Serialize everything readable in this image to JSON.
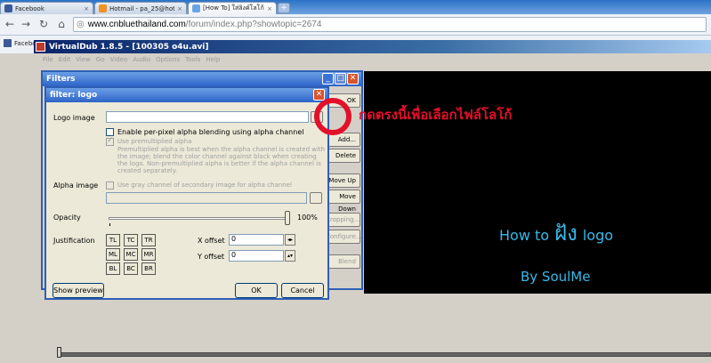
{
  "browser": {
    "tabs": [
      {
        "title": "Facebook",
        "color": "#3b5998"
      },
      {
        "title": "Hotmail - pa_25@hotmail.c...",
        "color": "#f29222"
      },
      {
        "title": "[How To] ใส่ลิงค์โลโก้ลงในไฟ...",
        "color": "#6aa4e5"
      }
    ],
    "new_tab": "+",
    "url_host": "www.cnbluethailand.com",
    "url_path": "/forum/index.php?showtopic=2674",
    "bookmark": "Facebo"
  },
  "vdub": {
    "title": "VirtualDub 1.8.5 - [100305 o4u.avi]",
    "menu": [
      "File",
      "Edit",
      "View",
      "Go",
      "Video",
      "Audio",
      "Options",
      "Tools",
      "Help"
    ],
    "preview_line1_prefix": "How to",
    "preview_line1_big": "ฝัง",
    "preview_line1_suffix": "logo",
    "preview_line2": "By SoulMe"
  },
  "filters_window": {
    "title": "Filters",
    "buttons": [
      "OK",
      "Add...",
      "Delete",
      "Move Up",
      "Move Down",
      "Cropping...",
      "Configure...",
      "Blend"
    ]
  },
  "logo_dialog": {
    "title": "filter: logo",
    "logo_image_label": "Logo image",
    "logo_image_value": "",
    "browse_label": "...",
    "enable_alpha_label": "Enable per-pixel alpha blending using alpha channel",
    "premultiplied_label": "Use premultiplied alpha",
    "premultiplied_note": "Premultiplied alpha is best when the alpha channel is created with the image; blend the color channel against black when creating the logo. Non-premultiplied alpha is better if the alpha channel is created separately.",
    "alpha_image_label": "Alpha image",
    "gray_channel_label": "Use gray channel of secondary image for alpha channel",
    "opacity_label": "Opacity",
    "opacity_value": "100%",
    "opacity_level": 1.0,
    "justification_label": "Justification",
    "justification": [
      [
        "TL",
        "TC",
        "TR"
      ],
      [
        "ML",
        "MC",
        "MR"
      ],
      [
        "BL",
        "BC",
        "BR"
      ]
    ],
    "x_offset_label": "X offset",
    "x_offset_value": "0",
    "y_offset_label": "Y offset",
    "y_offset_value": "0",
    "show_preview": "Show preview",
    "ok": "OK",
    "cancel": "Cancel"
  },
  "annotation": {
    "text": "กดตรงนี้เพื่อเลือกไฟล์โลโก้",
    "color": "#e3102a"
  }
}
